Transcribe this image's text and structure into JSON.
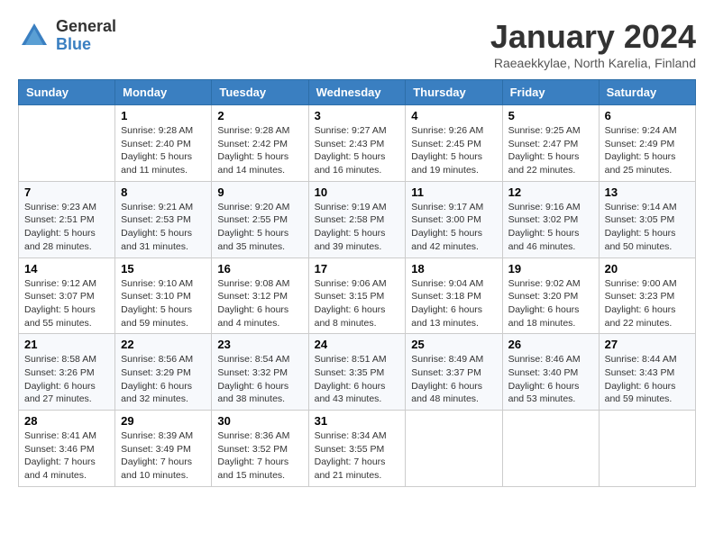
{
  "header": {
    "logo_general": "General",
    "logo_blue": "Blue",
    "title": "January 2024",
    "subtitle": "Raeaekkylae, North Karelia, Finland"
  },
  "days_of_week": [
    "Sunday",
    "Monday",
    "Tuesday",
    "Wednesday",
    "Thursday",
    "Friday",
    "Saturday"
  ],
  "weeks": [
    [
      {
        "num": "",
        "info": ""
      },
      {
        "num": "1",
        "info": "Sunrise: 9:28 AM\nSunset: 2:40 PM\nDaylight: 5 hours\nand 11 minutes."
      },
      {
        "num": "2",
        "info": "Sunrise: 9:28 AM\nSunset: 2:42 PM\nDaylight: 5 hours\nand 14 minutes."
      },
      {
        "num": "3",
        "info": "Sunrise: 9:27 AM\nSunset: 2:43 PM\nDaylight: 5 hours\nand 16 minutes."
      },
      {
        "num": "4",
        "info": "Sunrise: 9:26 AM\nSunset: 2:45 PM\nDaylight: 5 hours\nand 19 minutes."
      },
      {
        "num": "5",
        "info": "Sunrise: 9:25 AM\nSunset: 2:47 PM\nDaylight: 5 hours\nand 22 minutes."
      },
      {
        "num": "6",
        "info": "Sunrise: 9:24 AM\nSunset: 2:49 PM\nDaylight: 5 hours\nand 25 minutes."
      }
    ],
    [
      {
        "num": "7",
        "info": "Sunrise: 9:23 AM\nSunset: 2:51 PM\nDaylight: 5 hours\nand 28 minutes."
      },
      {
        "num": "8",
        "info": "Sunrise: 9:21 AM\nSunset: 2:53 PM\nDaylight: 5 hours\nand 31 minutes."
      },
      {
        "num": "9",
        "info": "Sunrise: 9:20 AM\nSunset: 2:55 PM\nDaylight: 5 hours\nand 35 minutes."
      },
      {
        "num": "10",
        "info": "Sunrise: 9:19 AM\nSunset: 2:58 PM\nDaylight: 5 hours\nand 39 minutes."
      },
      {
        "num": "11",
        "info": "Sunrise: 9:17 AM\nSunset: 3:00 PM\nDaylight: 5 hours\nand 42 minutes."
      },
      {
        "num": "12",
        "info": "Sunrise: 9:16 AM\nSunset: 3:02 PM\nDaylight: 5 hours\nand 46 minutes."
      },
      {
        "num": "13",
        "info": "Sunrise: 9:14 AM\nSunset: 3:05 PM\nDaylight: 5 hours\nand 50 minutes."
      }
    ],
    [
      {
        "num": "14",
        "info": "Sunrise: 9:12 AM\nSunset: 3:07 PM\nDaylight: 5 hours\nand 55 minutes."
      },
      {
        "num": "15",
        "info": "Sunrise: 9:10 AM\nSunset: 3:10 PM\nDaylight: 5 hours\nand 59 minutes."
      },
      {
        "num": "16",
        "info": "Sunrise: 9:08 AM\nSunset: 3:12 PM\nDaylight: 6 hours\nand 4 minutes."
      },
      {
        "num": "17",
        "info": "Sunrise: 9:06 AM\nSunset: 3:15 PM\nDaylight: 6 hours\nand 8 minutes."
      },
      {
        "num": "18",
        "info": "Sunrise: 9:04 AM\nSunset: 3:18 PM\nDaylight: 6 hours\nand 13 minutes."
      },
      {
        "num": "19",
        "info": "Sunrise: 9:02 AM\nSunset: 3:20 PM\nDaylight: 6 hours\nand 18 minutes."
      },
      {
        "num": "20",
        "info": "Sunrise: 9:00 AM\nSunset: 3:23 PM\nDaylight: 6 hours\nand 22 minutes."
      }
    ],
    [
      {
        "num": "21",
        "info": "Sunrise: 8:58 AM\nSunset: 3:26 PM\nDaylight: 6 hours\nand 27 minutes."
      },
      {
        "num": "22",
        "info": "Sunrise: 8:56 AM\nSunset: 3:29 PM\nDaylight: 6 hours\nand 32 minutes."
      },
      {
        "num": "23",
        "info": "Sunrise: 8:54 AM\nSunset: 3:32 PM\nDaylight: 6 hours\nand 38 minutes."
      },
      {
        "num": "24",
        "info": "Sunrise: 8:51 AM\nSunset: 3:35 PM\nDaylight: 6 hours\nand 43 minutes."
      },
      {
        "num": "25",
        "info": "Sunrise: 8:49 AM\nSunset: 3:37 PM\nDaylight: 6 hours\nand 48 minutes."
      },
      {
        "num": "26",
        "info": "Sunrise: 8:46 AM\nSunset: 3:40 PM\nDaylight: 6 hours\nand 53 minutes."
      },
      {
        "num": "27",
        "info": "Sunrise: 8:44 AM\nSunset: 3:43 PM\nDaylight: 6 hours\nand 59 minutes."
      }
    ],
    [
      {
        "num": "28",
        "info": "Sunrise: 8:41 AM\nSunset: 3:46 PM\nDaylight: 7 hours\nand 4 minutes."
      },
      {
        "num": "29",
        "info": "Sunrise: 8:39 AM\nSunset: 3:49 PM\nDaylight: 7 hours\nand 10 minutes."
      },
      {
        "num": "30",
        "info": "Sunrise: 8:36 AM\nSunset: 3:52 PM\nDaylight: 7 hours\nand 15 minutes."
      },
      {
        "num": "31",
        "info": "Sunrise: 8:34 AM\nSunset: 3:55 PM\nDaylight: 7 hours\nand 21 minutes."
      },
      {
        "num": "",
        "info": ""
      },
      {
        "num": "",
        "info": ""
      },
      {
        "num": "",
        "info": ""
      }
    ]
  ]
}
